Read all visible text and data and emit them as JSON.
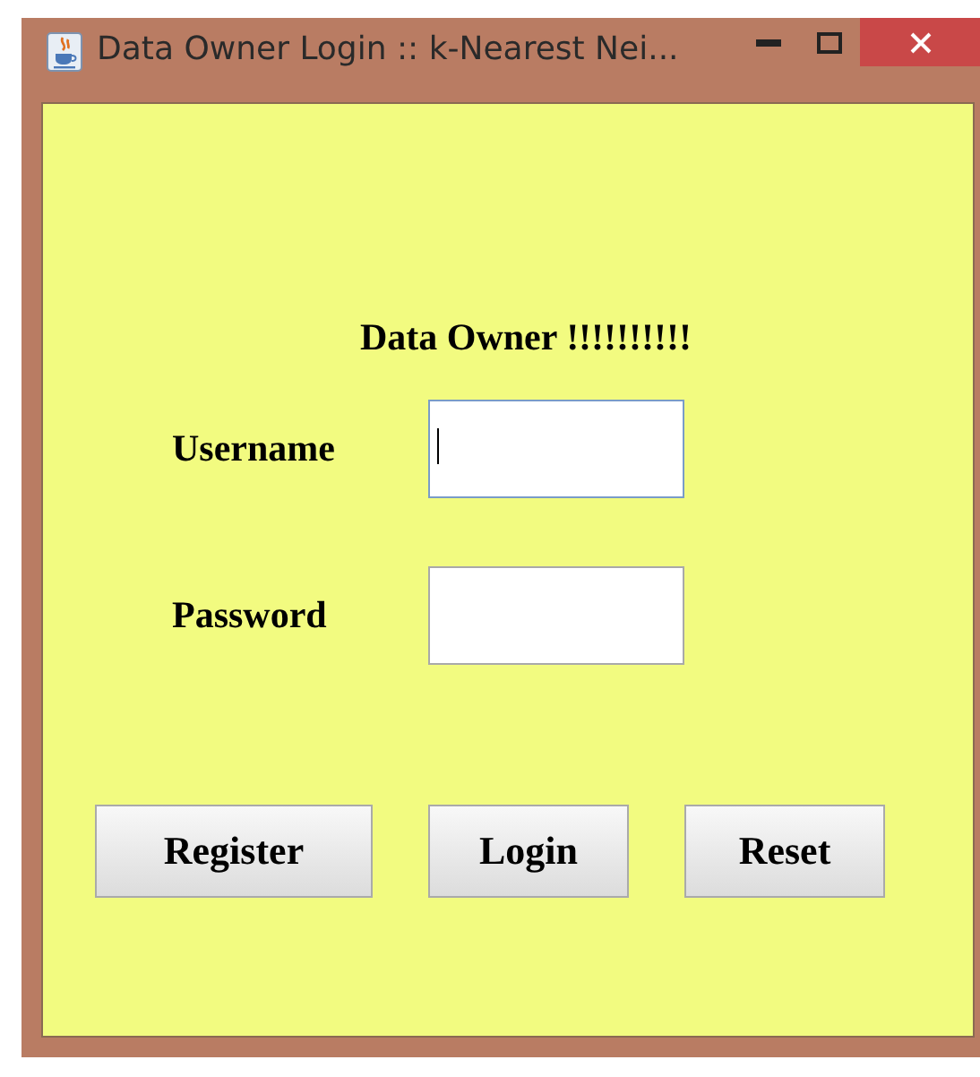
{
  "window": {
    "title": "Data Owner Login :: k-Nearest Nei..."
  },
  "heading": "Data Owner !!!!!!!!!!",
  "fields": [
    {
      "label": "Username",
      "focused": true
    },
    {
      "label": "Password",
      "focused": false
    }
  ],
  "buttons": [
    "Register",
    "Login",
    "Reset"
  ]
}
